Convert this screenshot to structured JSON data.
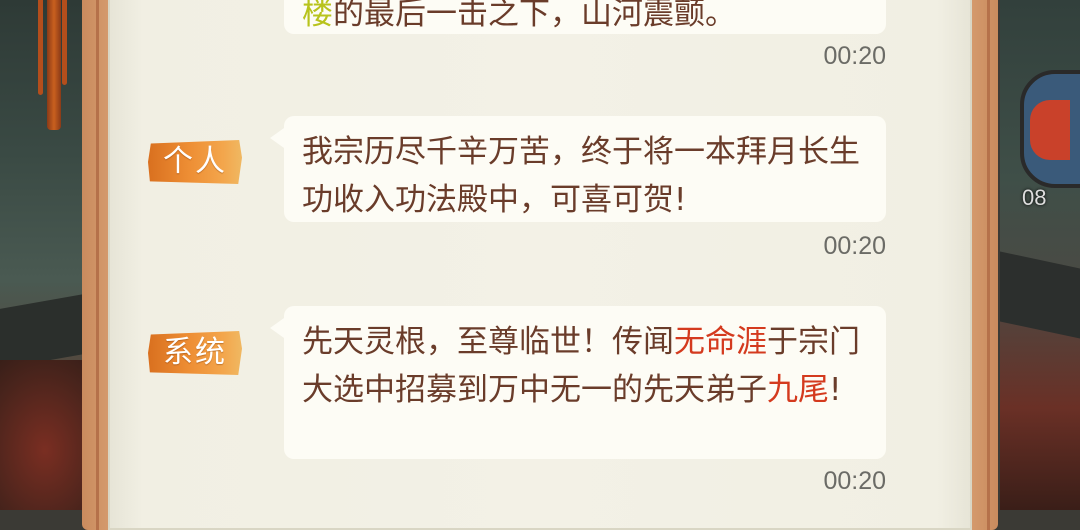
{
  "messages": [
    {
      "channel": "",
      "segments": [
        {
          "text": "楼",
          "style": "green"
        },
        {
          "text": "的最后一击之下，山河震颤。",
          "style": "normal"
        }
      ],
      "time": "00:20"
    },
    {
      "channel": "个人",
      "segments": [
        {
          "text": "我宗历尽千辛万苦，终于将一本拜月长生功收入功法殿中，可喜可贺!",
          "style": "normal"
        }
      ],
      "time": "00:20"
    },
    {
      "channel": "系统",
      "segments": [
        {
          "text": "先天灵根，至尊临世！传闻",
          "style": "normal"
        },
        {
          "text": "无命涯",
          "style": "red"
        },
        {
          "text": "于宗门大选中招募到万中无一的先天弟子",
          "style": "normal"
        },
        {
          "text": "九尾",
          "style": "red"
        },
        {
          "text": "!",
          "style": "normal"
        }
      ],
      "time": "00:20"
    }
  ],
  "background": {
    "right_level_text": "08"
  },
  "colors": {
    "tag_orange": "#ee8f35",
    "highlight_red": "#d43a1e",
    "highlight_green": "#b8c31c",
    "message_text": "#6a3c2a",
    "panel": "#f3f1e6"
  }
}
